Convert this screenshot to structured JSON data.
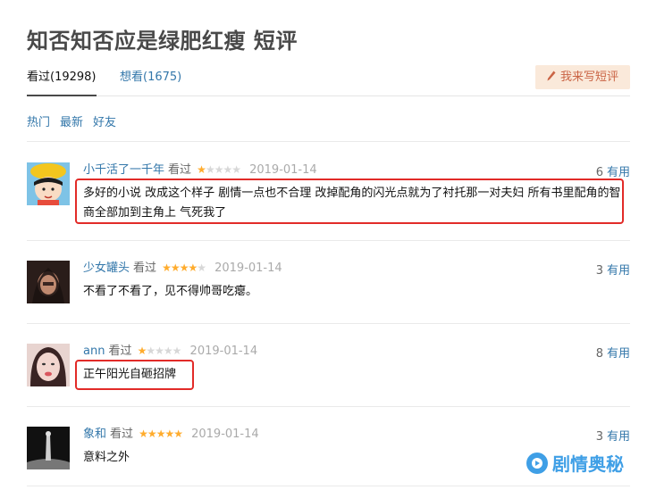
{
  "page": {
    "title": "知否知否应是绿肥红瘦 短评"
  },
  "tabs": {
    "watched": "看过(19298)",
    "wish": "想看(1675)"
  },
  "write_button": {
    "label": "我来写短评"
  },
  "sort": {
    "hot": "热门",
    "latest": "最新",
    "friends": "好友"
  },
  "useful_label": "有用",
  "comments": [
    {
      "user": "小千活了一千年",
      "status": "看过",
      "rating": 1,
      "date": "2019-01-14",
      "useful": "6",
      "text": "多好的小说 改成这个样子 剧情一点也不合理 改掉配角的闪光点就为了衬托那一对夫妇 所有书里配角的智商全部加到主角上 气死我了"
    },
    {
      "user": "少女罐头",
      "status": "看过",
      "rating": 4,
      "date": "2019-01-14",
      "useful": "3",
      "text": "不看了不看了，见不得帅哥吃瘪。"
    },
    {
      "user": "ann",
      "status": "看过",
      "rating": 1,
      "date": "2019-01-14",
      "useful": "8",
      "text": "正午阳光自砸招牌"
    },
    {
      "user": "象和",
      "status": "看过",
      "rating": 5,
      "date": "2019-01-14",
      "useful": "3",
      "text": "意料之外"
    }
  ],
  "watermark": {
    "text": "剧情奥秘"
  },
  "colors": {
    "link": "#3377aa",
    "star": "#ffac2d",
    "highlight_box": "#e22b28",
    "watermark": "#3f9fe6"
  }
}
